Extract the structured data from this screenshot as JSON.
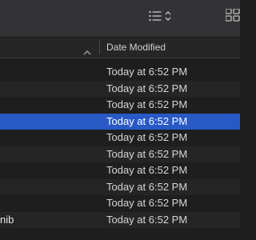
{
  "toolbar": {
    "view_options_icon": "list-view-icon",
    "view_options_chevron": "up-down-chevron-icon",
    "grid_icon": "grid-view-icon"
  },
  "columns": {
    "name": {
      "label": "",
      "sort_direction": "ascending",
      "sort_icon": "chevron-up-icon"
    },
    "date_modified": {
      "label": "Date Modified"
    }
  },
  "rows": [
    {
      "name": "",
      "date_modified": "Today at 6:52 PM",
      "selected": false
    },
    {
      "name": "",
      "date_modified": "Today at 6:52 PM",
      "selected": false
    },
    {
      "name": "",
      "date_modified": "Today at 6:52 PM",
      "selected": false
    },
    {
      "name": "",
      "date_modified": "Today at 6:52 PM",
      "selected": true
    },
    {
      "name": "",
      "date_modified": "Today at 6:52 PM",
      "selected": false
    },
    {
      "name": "",
      "date_modified": "Today at 6:52 PM",
      "selected": false
    },
    {
      "name": "",
      "date_modified": "Today at 6:52 PM",
      "selected": false
    },
    {
      "name": "",
      "date_modified": "Today at 6:52 PM",
      "selected": false
    },
    {
      "name": "",
      "date_modified": "Today at 6:52 PM",
      "selected": false
    },
    {
      "name": "nib",
      "date_modified": "Today at 6:52 PM",
      "selected": false
    }
  ],
  "colors": {
    "background": "#1e1e1e",
    "alternate_row": "#252525",
    "selection": "#2859c5",
    "toolbar": "#333235"
  }
}
